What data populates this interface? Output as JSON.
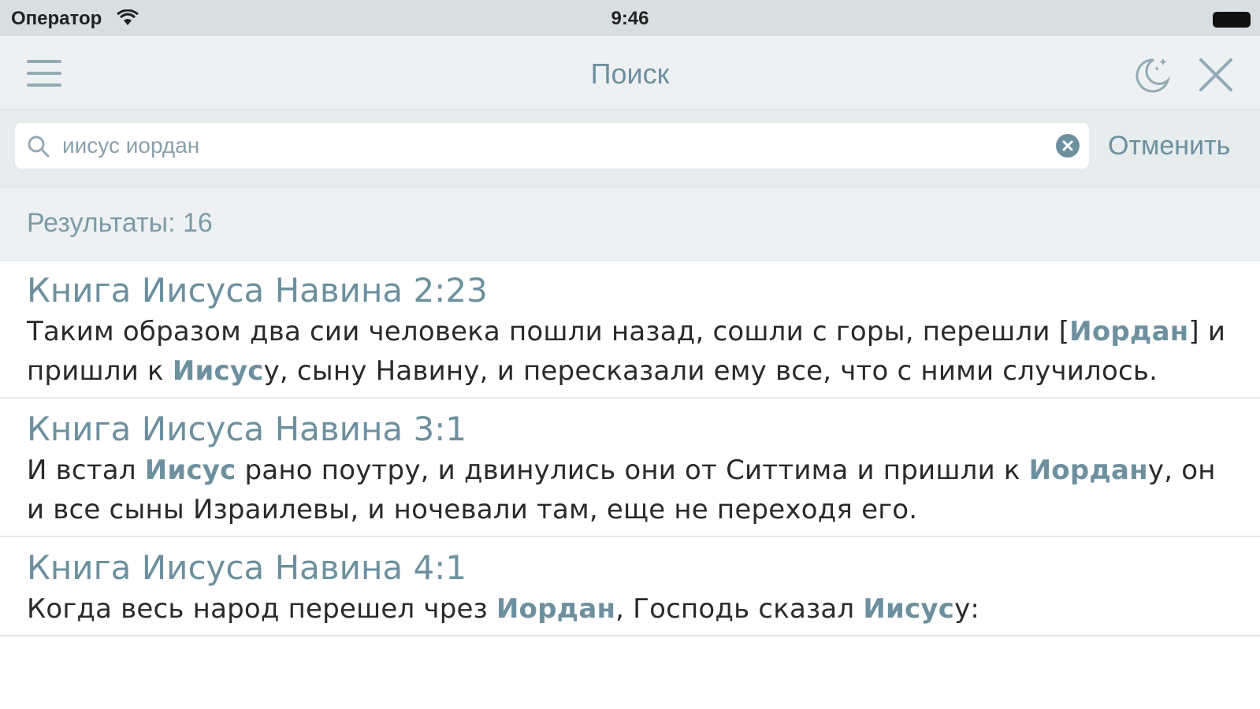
{
  "status_bar": {
    "carrier": "Оператор",
    "time": "9:46"
  },
  "nav": {
    "title": "Поиск",
    "icons": [
      "menu-icon",
      "night-mode-icon",
      "close-icon"
    ]
  },
  "search": {
    "value": "иисус иордан",
    "cancel_label": "Отменить"
  },
  "results": {
    "count_label": "Результаты: 16",
    "items": [
      {
        "ref": "Книга Иисуса Навина 2:23",
        "segments": [
          {
            "t": "Таким образом два сии человека пошли назад, сошли с горы, перешли [",
            "hl": false
          },
          {
            "t": "Иордан",
            "hl": true
          },
          {
            "t": "] и пришли к ",
            "hl": false
          },
          {
            "t": "Иисус",
            "hl": true
          },
          {
            "t": "у, сыну Навину, и пересказали ему все, что с ними случилось.",
            "hl": false
          }
        ]
      },
      {
        "ref": "Книга Иисуса Навина 3:1",
        "segments": [
          {
            "t": "И встал ",
            "hl": false
          },
          {
            "t": "Иисус",
            "hl": true
          },
          {
            "t": " рано поутру, и двинулись они от Ситтима и пришли к ",
            "hl": false
          },
          {
            "t": "Иордан",
            "hl": true
          },
          {
            "t": "у, он и все сыны Израилевы, и ночевали там, еще не переходя его.",
            "hl": false
          }
        ]
      },
      {
        "ref": "Книга Иисуса Навина 4:1",
        "segments": [
          {
            "t": "Когда весь народ перешел чрез ",
            "hl": false
          },
          {
            "t": "Иордан",
            "hl": true
          },
          {
            "t": ", Господь сказал ",
            "hl": false
          },
          {
            "t": "Иисус",
            "hl": true
          },
          {
            "t": "у:",
            "hl": false
          }
        ]
      }
    ]
  },
  "colors": {
    "accent": "#6d909f",
    "nav_background": "#edf1f3",
    "status_background": "#d8dfe3",
    "text": "#2a2a2a"
  }
}
